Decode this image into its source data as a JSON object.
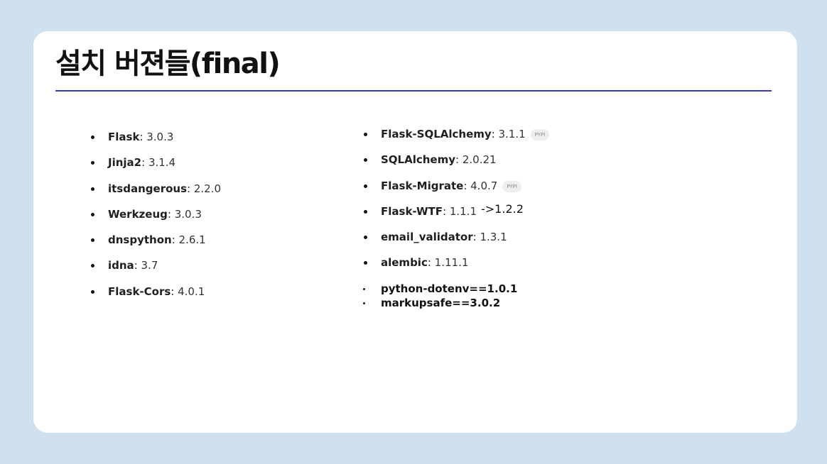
{
  "slide": {
    "title": "설치 버젼들(final)"
  },
  "left_list": [
    {
      "name": "Flask",
      "version": "3.0.3"
    },
    {
      "name": "Jinja2",
      "version": "3.1.4"
    },
    {
      "name": "itsdangerous",
      "version": "2.2.0"
    },
    {
      "name": "Werkzeug",
      "version": "3.0.3"
    },
    {
      "name": "dnspython",
      "version": "2.6.1"
    },
    {
      "name": "idna",
      "version": "3.7"
    },
    {
      "name": "Flask-Cors",
      "version": "4.0.1"
    }
  ],
  "right_list": [
    {
      "name": "Flask-SQLAlchemy",
      "version": "3.1.1",
      "badge": "PYPI"
    },
    {
      "name": "SQLAlchemy",
      "version": "2.0.21"
    },
    {
      "name": "Flask-Migrate",
      "version": "4.0.7",
      "badge": "PYPI"
    },
    {
      "name": "Flask-WTF",
      "version": "1.1.1"
    },
    {
      "name": "email_validator",
      "version": "1.3.1"
    },
    {
      "name": "alembic",
      "version": "1.11.1"
    }
  ],
  "upgrade_note": "->1.2.2",
  "extra_list": [
    "python-dotenv==1.0.1",
    "markupsafe==3.0.2"
  ],
  "colors": {
    "background": "#cfe0ef",
    "card": "#ffffff",
    "rule": "#3a3ab8"
  }
}
